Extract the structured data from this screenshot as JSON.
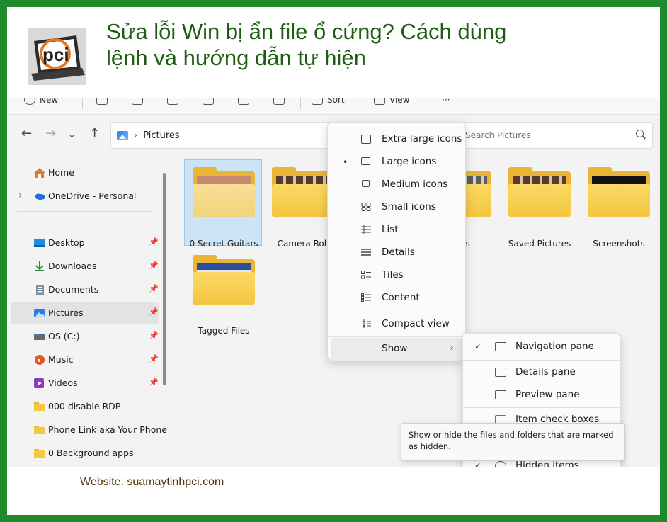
{
  "headline": {
    "line1": "Sửa lỗi Win bị ẩn file ổ cứng? Cách dùng",
    "line2": "lệnh và hướng dẫn tự hiện"
  },
  "logo": {
    "text": "pci",
    "colors": {
      "ring": "#e07a2c",
      "laptop": "#2b2b2b",
      "bg": "#d9d9d9"
    }
  },
  "explorer": {
    "cmdbar": {
      "new": "New",
      "sort": "Sort",
      "view": "View",
      "more": "···"
    },
    "address": {
      "path": "Pictures",
      "search_placeholder": "Search Pictures"
    },
    "sidebar": {
      "items": [
        {
          "label": "Home",
          "icon": "home-icon"
        },
        {
          "label": "OneDrive - Personal",
          "icon": "cloud-icon"
        },
        {
          "label": "Desktop",
          "icon": "desktop-icon"
        },
        {
          "label": "Downloads",
          "icon": "download-icon"
        },
        {
          "label": "Documents",
          "icon": "document-icon"
        },
        {
          "label": "Pictures",
          "icon": "pictures-icon"
        },
        {
          "label": "OS (C:)",
          "icon": "drive-icon"
        },
        {
          "label": "Music",
          "icon": "music-icon"
        },
        {
          "label": "Videos",
          "icon": "video-icon"
        },
        {
          "label": "000 disable RDP",
          "icon": "folder-icon"
        },
        {
          "label": "Phone Link aka Your Phone",
          "icon": "folder-icon"
        },
        {
          "label": "0 Background apps",
          "icon": "folder-icon"
        }
      ]
    },
    "folders": [
      {
        "label": "0 Secret Guitars"
      },
      {
        "label": "Camera Roll"
      },
      {
        "label": "cons"
      },
      {
        "label": "Saved Pictures"
      },
      {
        "label": "Screenshots"
      },
      {
        "label": "Tagged Files"
      }
    ],
    "view_menu": {
      "items": [
        {
          "label": "Extra large icons",
          "icon": "extra-large-icons-icon"
        },
        {
          "label": "Large icons",
          "icon": "large-icons-icon",
          "selected": true
        },
        {
          "label": "Medium icons",
          "icon": "medium-icons-icon"
        },
        {
          "label": "Small icons",
          "icon": "small-icons-icon"
        },
        {
          "label": "List",
          "icon": "list-icon"
        },
        {
          "label": "Details",
          "icon": "details-icon"
        },
        {
          "label": "Tiles",
          "icon": "tiles-icon"
        },
        {
          "label": "Content",
          "icon": "content-icon"
        }
      ],
      "compact": "Compact view",
      "show": "Show"
    },
    "show_menu": {
      "items": [
        {
          "label": "Navigation pane",
          "checked": true
        },
        {
          "label": "Details pane",
          "checked": false
        },
        {
          "label": "Preview pane",
          "checked": false
        },
        {
          "label": "Item check boxes",
          "checked": false
        },
        {
          "label": "Hidden items",
          "checked": true
        }
      ]
    },
    "tooltip": "Show or hide the files and folders that are marked as hidden."
  },
  "website": "Website: suamaytinhpci.com"
}
